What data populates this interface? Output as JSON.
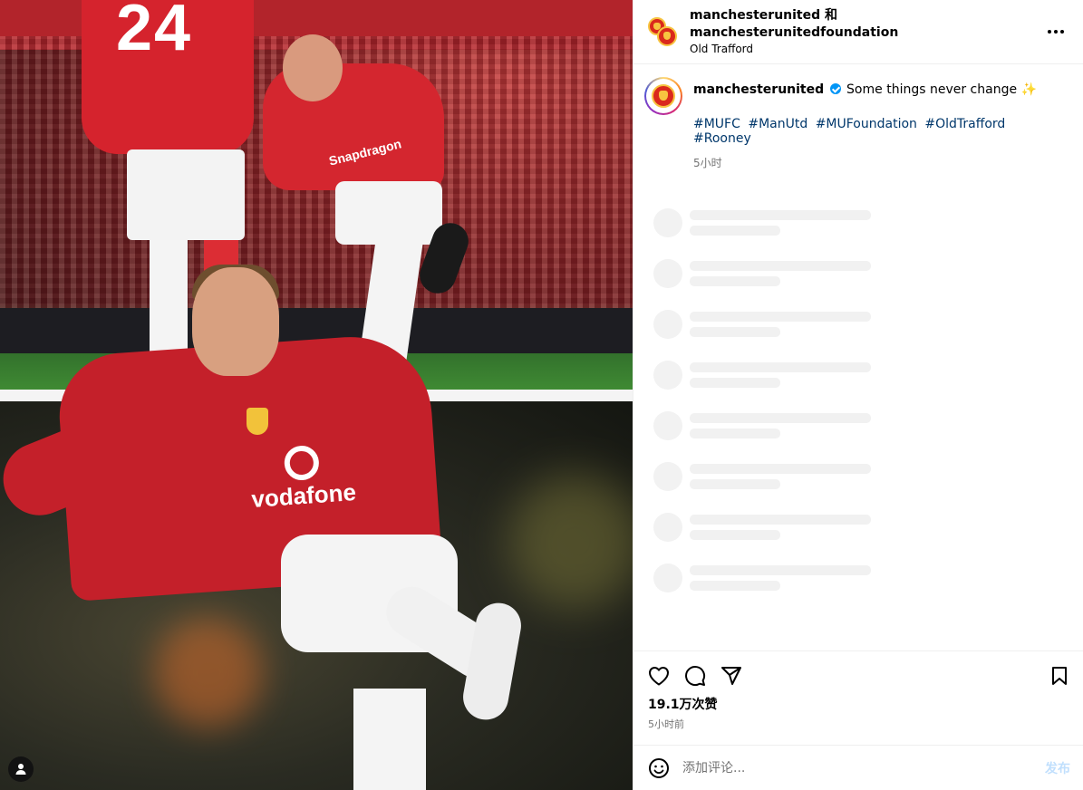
{
  "header": {
    "title": "manchesterunited 和 manchesterunitedfoundation",
    "location": "Old Trafford",
    "more_icon": "more-horizontal-icon"
  },
  "media": {
    "top_photo_number": "24",
    "top_photo_sponsor": "Snapdragon",
    "bottom_photo_sponsor": "vodafone",
    "user_tag_icon": "person-icon"
  },
  "caption": {
    "username": "manchesterunited",
    "text": "Some things never change ✨",
    "hashtags": [
      "#MUFC",
      "#ManUtd",
      "#MUFoundation",
      "#OldTrafford",
      "#Rooney"
    ],
    "time": "5小时"
  },
  "actions": {
    "likes": "19.1万次赞",
    "time": "5小时前",
    "icons": [
      "heart-icon",
      "comment-icon",
      "share-icon",
      "bookmark-icon"
    ]
  },
  "comment": {
    "placeholder": "添加评论...",
    "post_label": "发布"
  },
  "colors": {
    "link": "#00376b",
    "muted": "#737373",
    "verified": "#0095f6",
    "post_disabled": "#c0dffd",
    "brand_red": "#da291c"
  }
}
